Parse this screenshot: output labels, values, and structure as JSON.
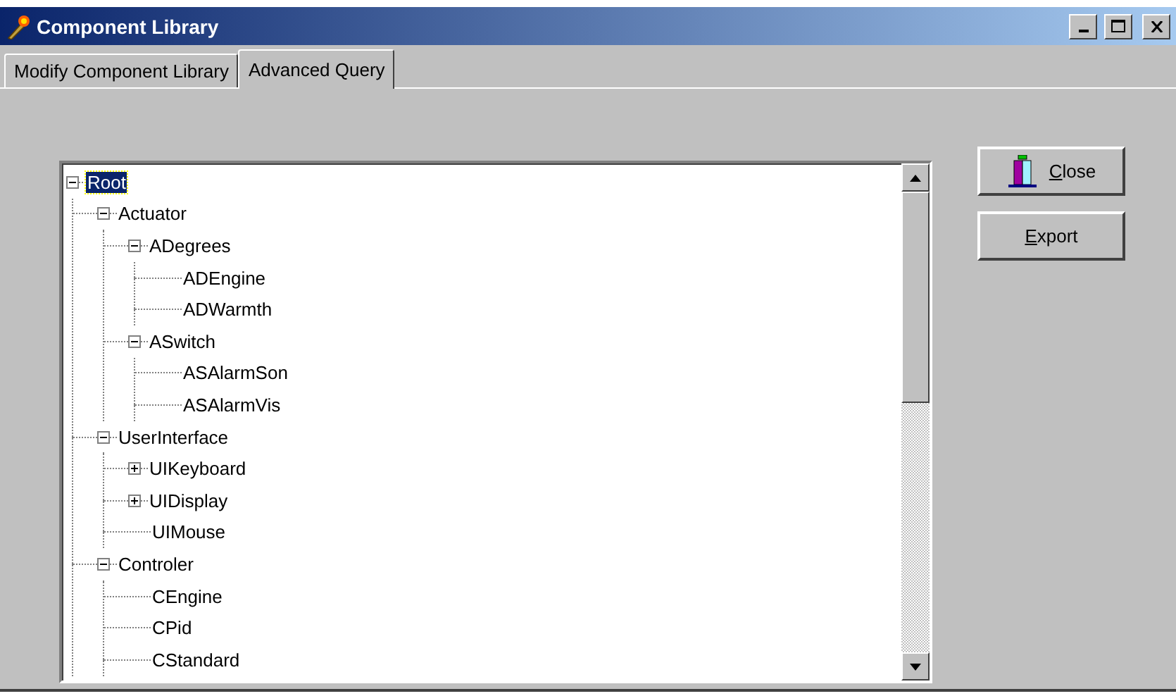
{
  "window": {
    "title": "Component Library"
  },
  "tabs": [
    {
      "label": "Modify Component Library",
      "selected": false
    },
    {
      "label": "Advanced Query",
      "selected": true
    }
  ],
  "tree": [
    {
      "label": "Root",
      "selected": true,
      "expanded": true,
      "children": [
        {
          "label": "Actuator",
          "selected": false,
          "expanded": true,
          "children": [
            {
              "label": "ADegrees",
              "selected": false,
              "expanded": true,
              "children": [
                {
                  "label": "ADEngine",
                  "selected": false
                },
                {
                  "label": "ADWarmth",
                  "selected": false
                }
              ]
            },
            {
              "label": "ASwitch",
              "selected": false,
              "expanded": true,
              "children": [
                {
                  "label": "ASAlarmSon",
                  "selected": false
                },
                {
                  "label": "ASAlarmVis",
                  "selected": false
                }
              ]
            }
          ]
        },
        {
          "label": "UserInterface",
          "selected": false,
          "expanded": true,
          "children": [
            {
              "label": "UIKeyboard",
              "selected": false,
              "expanded": false
            },
            {
              "label": "UIDisplay",
              "selected": false,
              "expanded": false
            },
            {
              "label": "UIMouse",
              "selected": false
            }
          ]
        },
        {
          "label": "Controler",
          "selected": false,
          "expanded": true,
          "children": [
            {
              "label": "CEngine",
              "selected": false
            },
            {
              "label": "CPid",
              "selected": false
            },
            {
              "label": "CStandard",
              "selected": false
            }
          ]
        }
      ]
    }
  ],
  "buttons": [
    {
      "label": "Close",
      "kind": "close"
    },
    {
      "label": "Export",
      "kind": "plain"
    }
  ]
}
